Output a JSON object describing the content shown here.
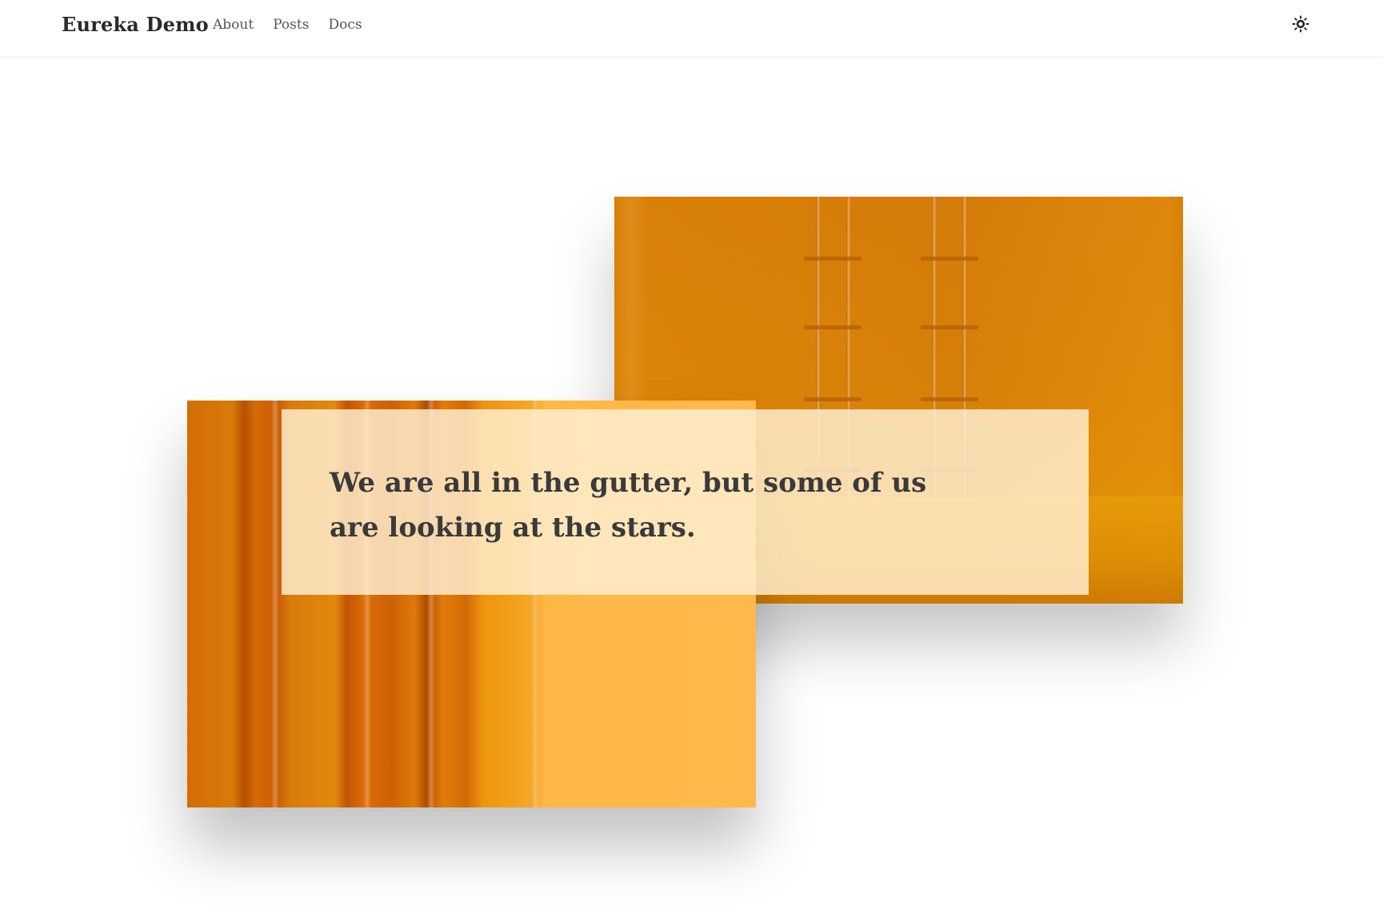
{
  "header": {
    "brand": "Eureka Demo",
    "nav": [
      {
        "label": "About"
      },
      {
        "label": "Posts"
      },
      {
        "label": "Docs"
      }
    ],
    "theme_toggle_icon": "sun-icon"
  },
  "hero": {
    "quote": "We are all in the gutter, but some of us are looking at the stars.",
    "accent_color": "#e08a08",
    "quote_box_color": "#fff0d4",
    "text_color": "#3a3a3a"
  }
}
